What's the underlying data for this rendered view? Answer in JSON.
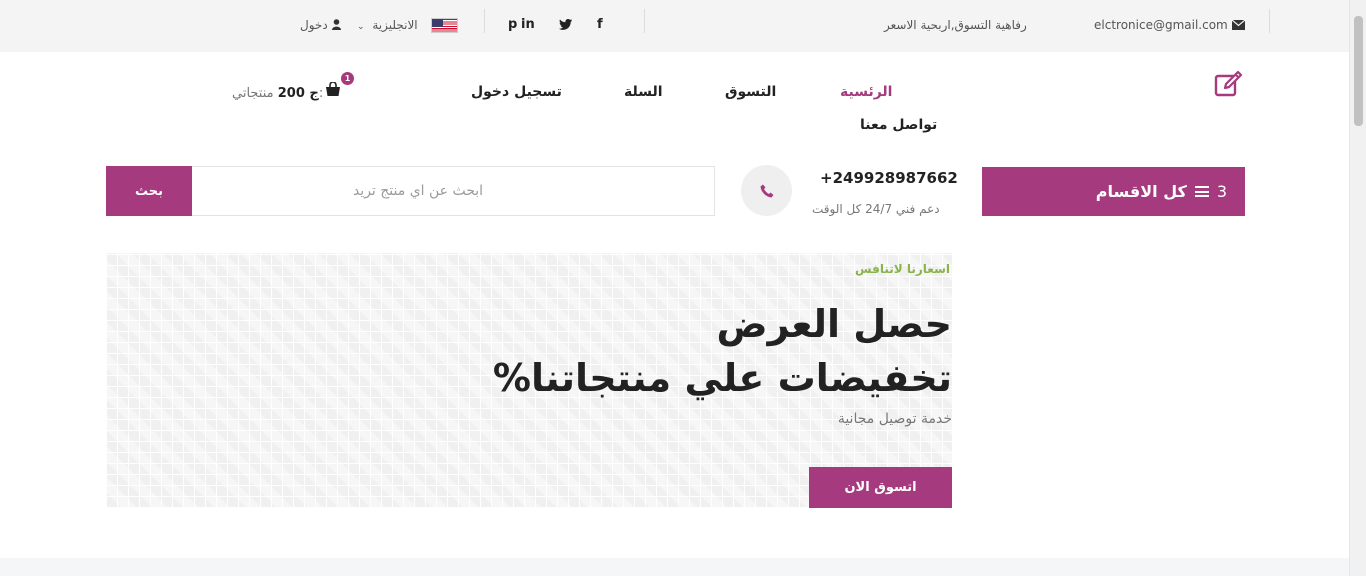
{
  "topbar": {
    "email": "elctronice@gmail.com",
    "tagline": "رفاهية التسوق,اربحية الاسعر",
    "login": "دخول",
    "language": "الانجليزية",
    "social": [
      "f",
      "t",
      "in",
      "p"
    ]
  },
  "nav": {
    "home": "الرئسية",
    "shop": "التسوق",
    "cart": "السلة",
    "register": "تسجيل دخول",
    "contact": "تواصل معنا"
  },
  "cart": {
    "label": "منتجاتي:",
    "amount": "ج 200",
    "count": "1"
  },
  "categories": {
    "label": "كل الاقسام",
    "count": "3"
  },
  "support": {
    "phone": "+249928987662",
    "text": "دعم فني 24/7 كل الوقت"
  },
  "search": {
    "placeholder": "ابحث عن اي منتج تريد",
    "button": "بحث"
  },
  "hero": {
    "tag": "اسعارنا لاتنافس",
    "title_line1": "حصل العرض",
    "title_line2": "%تخفيضات علي منتجاتنا",
    "subtitle": "خدمة توصيل مجانية",
    "button": "اتسوق الان"
  },
  "colors": {
    "accent": "#a63a7f",
    "tag_green": "#8bb34b"
  }
}
